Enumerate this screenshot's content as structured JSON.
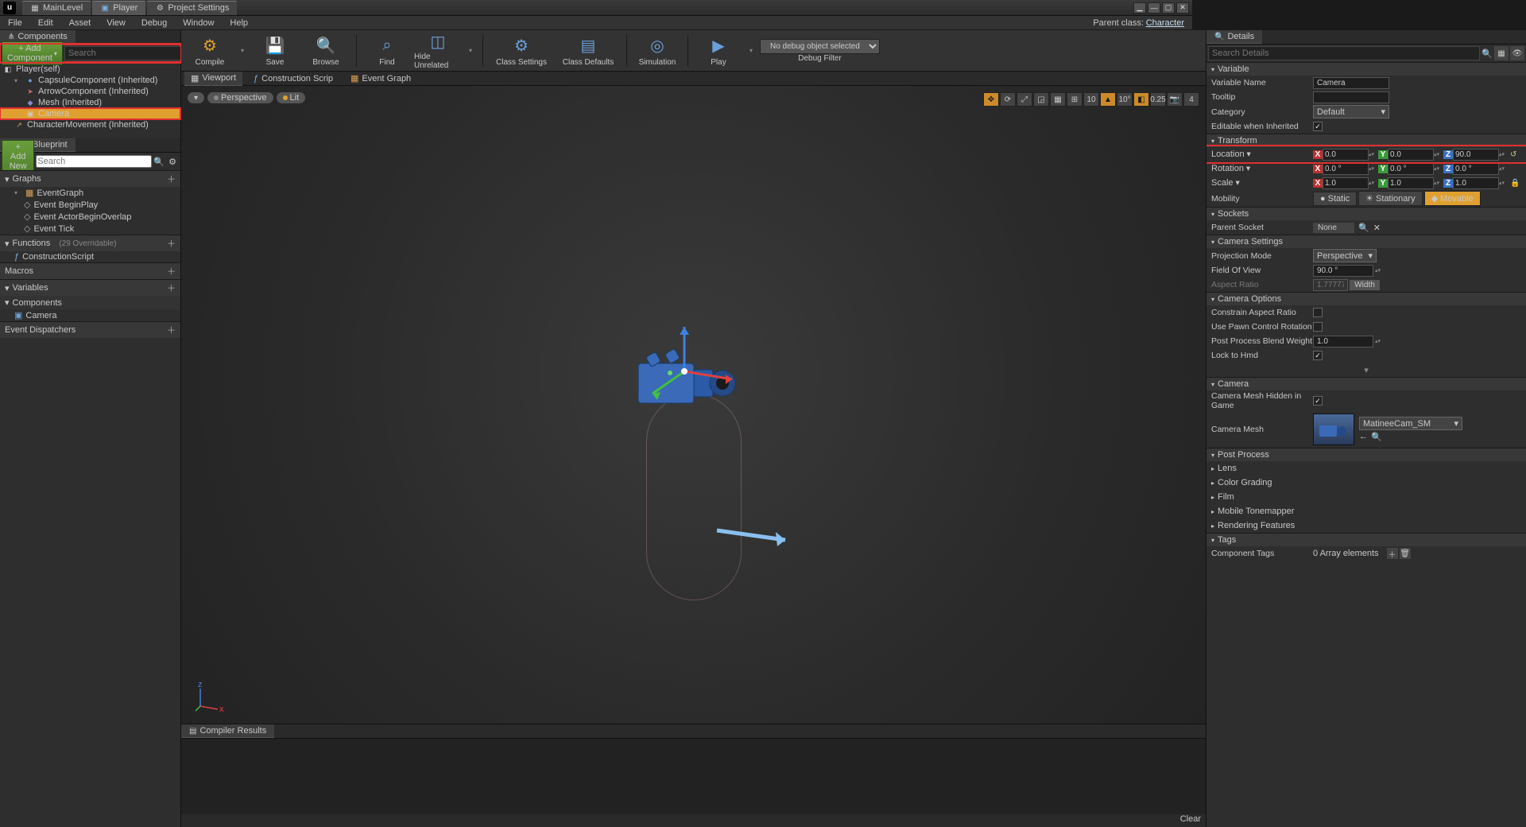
{
  "titlebar": {
    "tabs": [
      "MainLevel",
      "Player",
      "Project Settings"
    ]
  },
  "menubar": {
    "items": [
      "File",
      "Edit",
      "Asset",
      "View",
      "Debug",
      "Window",
      "Help"
    ],
    "parent_label": "Parent class:",
    "parent_class": "Character"
  },
  "components": {
    "title": "Components",
    "add_btn": "+ Add Component",
    "search_ph": "Search",
    "tree": [
      {
        "label": "Player(self)",
        "indent": 0
      },
      {
        "label": "CapsuleComponent (Inherited)",
        "indent": 1,
        "arrow": "▾",
        "ico": "●"
      },
      {
        "label": "ArrowComponent (Inherited)",
        "indent": 2,
        "ico": "➤"
      },
      {
        "label": "Mesh (Inherited)",
        "indent": 2,
        "ico": "◆"
      },
      {
        "label": "Camera",
        "indent": 2,
        "ico": "▣",
        "sel": true,
        "hl": true
      },
      {
        "label": "CharacterMovement (Inherited)",
        "indent": 1,
        "ico": "↗"
      }
    ]
  },
  "mybp": {
    "title": "My Blueprint",
    "add": "+ Add New",
    "search_ph": "Search",
    "sections": {
      "graphs": "Graphs",
      "eventgraph": "EventGraph",
      "ev1": "Event BeginPlay",
      "ev2": "Event ActorBeginOverlap",
      "ev3": "Event Tick",
      "functions": "Functions",
      "functions_note": "(29 Overridable)",
      "construction": "ConstructionScript",
      "macros": "Macros",
      "variables": "Variables",
      "components": "Components",
      "cam": "Camera",
      "dispatch": "Event Dispatchers"
    }
  },
  "toolbar": {
    "compile": "Compile",
    "save": "Save",
    "browse": "Browse",
    "find": "Find",
    "hide": "Hide Unrelated",
    "class_set": "Class Settings",
    "class_def": "Class Defaults",
    "sim": "Simulation",
    "play": "Play",
    "debug_sel": "No debug object selected",
    "debug_filter": "Debug Filter"
  },
  "viewport": {
    "tabs": [
      "Viewport",
      "Construction Scrip",
      "Event Graph"
    ],
    "pill_persp": "Perspective",
    "pill_lit": "Lit",
    "snap": [
      "10",
      "10°",
      "0.25",
      "4"
    ]
  },
  "compiler": {
    "title": "Compiler Results",
    "clear": "Clear"
  },
  "details": {
    "title": "Details",
    "search_ph": "Search Details",
    "variable": {
      "head": "Variable",
      "name_lbl": "Variable Name",
      "name_val": "Camera",
      "tooltip_lbl": "Tooltip",
      "category_lbl": "Category",
      "category_val": "Default",
      "editable_lbl": "Editable when Inherited"
    },
    "transform": {
      "head": "Transform",
      "location_lbl": "Location",
      "loc": {
        "x": "0.0",
        "y": "0.0",
        "z": "90.0"
      },
      "rotation_lbl": "Rotation",
      "rot": {
        "x": "0.0 °",
        "y": "0.0 °",
        "z": "0.0 °"
      },
      "scale_lbl": "Scale",
      "scl": {
        "x": "1.0",
        "y": "1.0",
        "z": "1.0"
      },
      "mobility_lbl": "Mobility",
      "mob_static": "Static",
      "mob_stationary": "Stationary",
      "mob_movable": "Movable"
    },
    "sockets": {
      "head": "Sockets",
      "parent_lbl": "Parent Socket",
      "val": "None"
    },
    "camset": {
      "head": "Camera Settings",
      "proj_lbl": "Projection Mode",
      "proj_val": "Perspective",
      "fov_lbl": "Field Of View",
      "fov_val": "90.0 °",
      "aspect_lbl": "Aspect Ratio",
      "aspect_val": "1.777778",
      "aspect_btn": "Width"
    },
    "camopt": {
      "head": "Camera Options",
      "constrain": "Constrain Aspect Ratio",
      "pawn": "Use Pawn Control Rotation",
      "blend": "Post Process Blend Weight",
      "blend_val": "1.0",
      "lock": "Lock to Hmd"
    },
    "camera": {
      "head": "Camera",
      "hidden": "Camera Mesh Hidden in Game",
      "mesh_lbl": "Camera Mesh",
      "mesh_val": "MatineeCam_SM"
    },
    "post": {
      "head": "Post Process",
      "sub": [
        "Lens",
        "Color Grading",
        "Film",
        "Mobile Tonemapper",
        "Rendering Features"
      ]
    },
    "tags": {
      "head": "Tags",
      "comp_lbl": "Component Tags",
      "comp_val": "0 Array elements"
    }
  }
}
